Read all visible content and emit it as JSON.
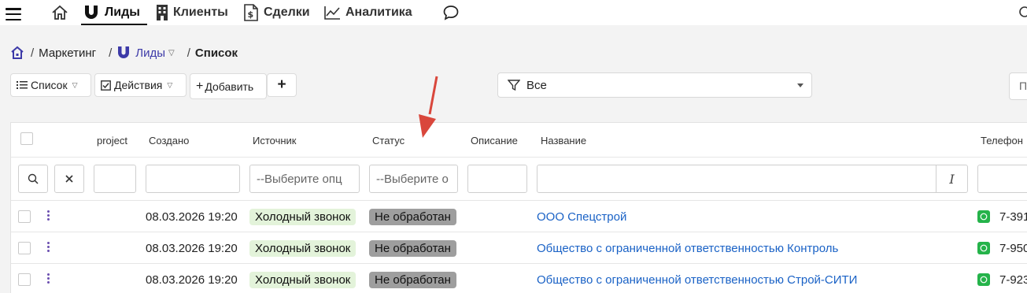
{
  "nav": {
    "items": [
      {
        "label": "Лиды",
        "icon": "magnet-icon",
        "active": true
      },
      {
        "label": "Клиенты",
        "icon": "building-icon"
      },
      {
        "label": "Сделки",
        "icon": "document-dollar-icon"
      },
      {
        "label": "Аналитика",
        "icon": "chart-line-icon"
      }
    ]
  },
  "breadcrumb": {
    "section": "Маркетинг",
    "leads": "Лиды",
    "current": "Список"
  },
  "toolbar": {
    "list_label": "Список",
    "actions_label": "Действия",
    "add_label": "Добавить",
    "plus_label": "+"
  },
  "filter": {
    "value": "Все"
  },
  "right_partial": "П",
  "table": {
    "columns": {
      "project": "project",
      "created": "Создано",
      "source": "Источник",
      "status": "Статус",
      "description": "Описание",
      "name": "Название",
      "phone": "Телефон"
    },
    "filters": {
      "source_placeholder": "--Выберите опц",
      "status_placeholder": "--Выберите о"
    },
    "rows": [
      {
        "created": "08.03.2026 19:20",
        "source": "Холодный звонок",
        "status": "Не обработан",
        "name": "ООО Спецстрой",
        "phone": "7-391"
      },
      {
        "created": "08.03.2026 19:20",
        "source": "Холодный звонок",
        "status": "Не обработан",
        "name": "Общество с ограниченной ответственностью Контроль",
        "phone": "7-950"
      },
      {
        "created": "08.03.2026 19:20",
        "source": "Холодный звонок",
        "status": "Не обработан",
        "name": "Общество с ограниченной ответственностью Строй-СИТИ",
        "phone": "7-923"
      }
    ]
  },
  "colors": {
    "accent": "#3d3aa8",
    "link": "#1a62c6",
    "tag_green": "#e3f3da",
    "tag_gray": "#9e9e9e",
    "arrow": "#d9473c",
    "whatsapp": "#25b34a"
  }
}
